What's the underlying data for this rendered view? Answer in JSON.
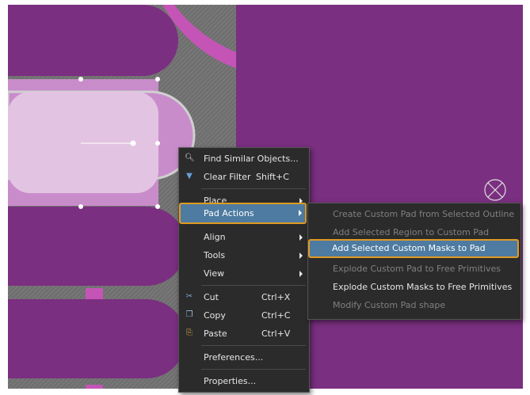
{
  "context_menu": {
    "items": [
      {
        "label": "Find Similar Objects...",
        "shortcut": "",
        "icon": "find-similar-icon"
      },
      {
        "label": "Clear Filter",
        "shortcut": "Shift+C",
        "icon": "clear-filter-icon"
      },
      {
        "label": "Place",
        "shortcut": "",
        "icon": ""
      },
      {
        "label": "Pad Actions",
        "shortcut": "",
        "icon": ""
      },
      {
        "label": "Align",
        "shortcut": "",
        "icon": ""
      },
      {
        "label": "Tools",
        "shortcut": "",
        "icon": ""
      },
      {
        "label": "View",
        "shortcut": "",
        "icon": ""
      },
      {
        "label": "Cut",
        "shortcut": "Ctrl+X",
        "icon": "cut-icon"
      },
      {
        "label": "Copy",
        "shortcut": "Ctrl+C",
        "icon": "copy-icon"
      },
      {
        "label": "Paste",
        "shortcut": "Ctrl+V",
        "icon": "paste-icon"
      },
      {
        "label": "Preferences...",
        "shortcut": "",
        "icon": ""
      },
      {
        "label": "Properties...",
        "shortcut": "",
        "icon": ""
      }
    ]
  },
  "pad_actions_submenu": {
    "items": [
      {
        "label": "Create Custom Pad from Selected Outline",
        "enabled": false
      },
      {
        "label": "Add Selected Region to Custom Pad",
        "enabled": false
      },
      {
        "label": "Add Selected Custom Masks to Pad",
        "enabled": true
      },
      {
        "label": "Explode Custom Pad to Free Primitives",
        "enabled": false
      },
      {
        "label": "Explode Custom Masks to Free Primitives",
        "enabled": true
      },
      {
        "label": "Modify Custom Pad shape",
        "enabled": false
      }
    ]
  },
  "colors": {
    "board": "#7a2f80",
    "pad_selected": "#e3bfe0",
    "menu_background": "#2b2b2b",
    "highlight": "#4e7ba1",
    "highlight_outline": "#e09a22"
  }
}
